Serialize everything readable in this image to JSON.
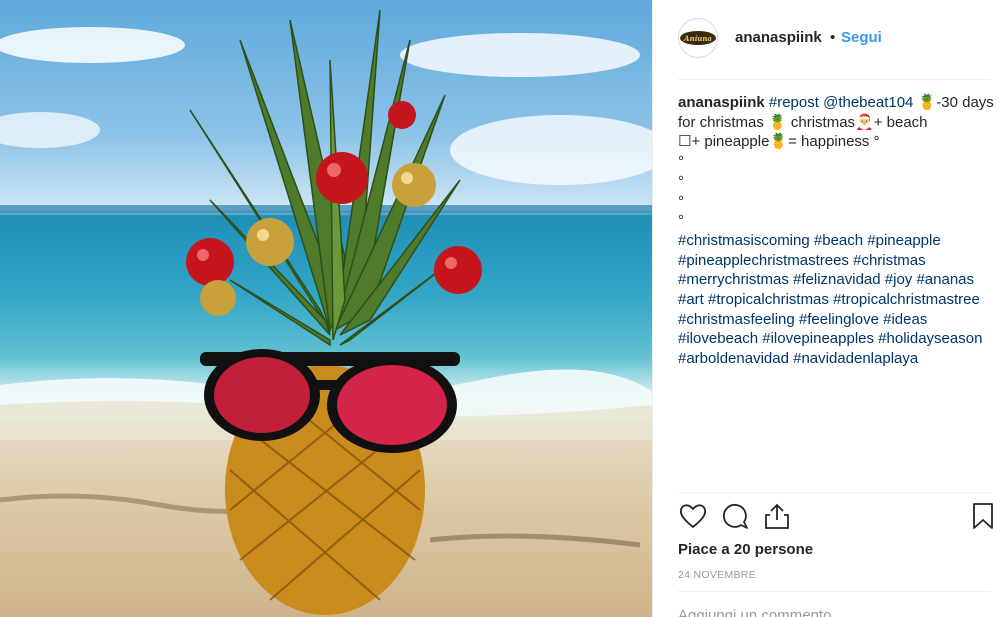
{
  "header": {
    "avatar_text": "Aníuna",
    "username": "ananaspiink",
    "separator": "•",
    "follow_label": "Segui"
  },
  "caption": {
    "username": "ananaspiink",
    "line1_repost": "#repost",
    "line1_mention": "@thebeat104",
    "line1_rest": "🍍-30",
    "line2": "days for christmas 🍍 christmas🎅+ beach",
    "line3": "☐+ pineapple🍍= happiness °",
    "dots": [
      "°",
      "°",
      "°",
      "°"
    ],
    "hashtags": [
      "#christmasiscoming",
      "#beach",
      "#pineapple",
      "#pineapplechristmastrees",
      "#christmas",
      "#merrychristmas",
      "#feliznavidad",
      "#joy",
      "#ananas",
      "#art",
      "#tropicalchristmas",
      "#tropicalchristmastree",
      "#christmasfeeling",
      "#feelinglove",
      "#ideas",
      "#ilovebeach",
      "#ilovepineapples",
      "#holidayseason",
      "#arboldenavidad",
      "#navidadenlaplaya"
    ]
  },
  "actions": {
    "like_icon": "heart-icon",
    "comment_icon": "comment-icon",
    "share_icon": "share-icon",
    "save_icon": "bookmark-icon"
  },
  "likes_text": "Piace a 20 persone",
  "date_text": "24 NOVEMBRE",
  "comment_placeholder": "Aggiungi un commento...",
  "colors": {
    "link": "#003569",
    "follow": "#3897f0",
    "text": "#262626",
    "muted": "#999999"
  }
}
